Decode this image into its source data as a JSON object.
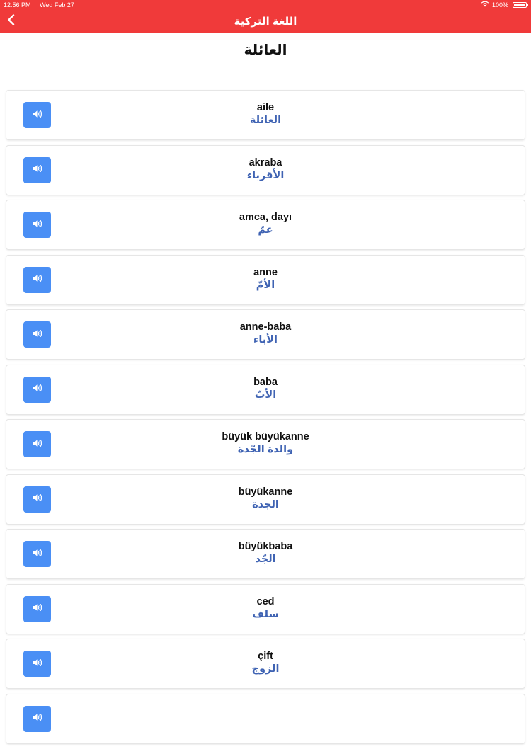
{
  "status_bar": {
    "time": "12:56 PM",
    "date": "Wed Feb 27",
    "battery": "100%"
  },
  "nav": {
    "title": "اللغة التركية",
    "back_icon": "chevron-left-icon"
  },
  "heading": "العائلة",
  "words": [
    {
      "turkish": "aile",
      "arabic": "العائلة"
    },
    {
      "turkish": "akraba",
      "arabic": "الأقرباء"
    },
    {
      "turkish": "amca, dayı",
      "arabic": "عمّ"
    },
    {
      "turkish": "anne",
      "arabic": "الأمّ"
    },
    {
      "turkish": "anne-baba",
      "arabic": "الأباء"
    },
    {
      "turkish": "baba",
      "arabic": "الأبّ"
    },
    {
      "turkish": "büyük büyükanne",
      "arabic": "والدة الجّدة"
    },
    {
      "turkish": "büyükanne",
      "arabic": "الجدة"
    },
    {
      "turkish": "büyükbaba",
      "arabic": "الجّد"
    },
    {
      "turkish": "ced",
      "arabic": "سلف"
    },
    {
      "turkish": "çift",
      "arabic": "الزوج"
    }
  ],
  "colors": {
    "bar": "#f03a3a",
    "speaker_button": "#4a8ff5",
    "arabic_text": "#3f63b3"
  },
  "icons": {
    "speaker": "speaker-icon",
    "wifi": "wifi-icon",
    "battery": "battery-icon"
  }
}
